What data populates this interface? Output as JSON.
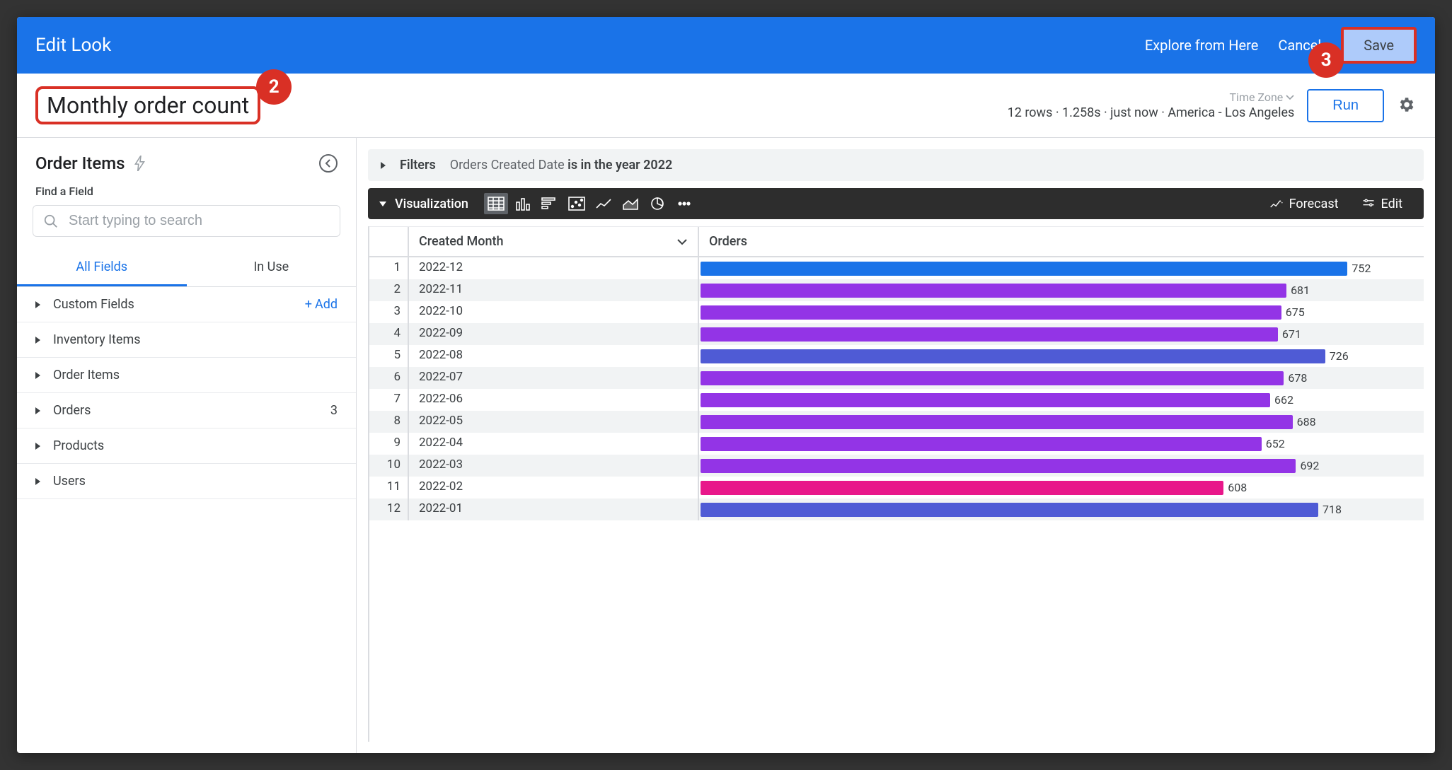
{
  "header": {
    "title": "Edit Look",
    "explore_label": "Explore from Here",
    "cancel_label": "Cancel",
    "save_label": "Save"
  },
  "callouts": {
    "title": "2",
    "save": "3"
  },
  "look": {
    "title": "Monthly order count",
    "stats": "12 rows · 1.258s · just now · America - Los Angeles",
    "timezone_label": "Time Zone",
    "run_label": "Run"
  },
  "sidebar": {
    "explore_name": "Order Items",
    "find_label": "Find a Field",
    "search_placeholder": "Start typing to search",
    "tabs": {
      "all": "All Fields",
      "in_use": "In Use"
    },
    "add_label": "Add",
    "groups": [
      {
        "name": "Custom Fields",
        "add": true
      },
      {
        "name": "Inventory Items"
      },
      {
        "name": "Order Items"
      },
      {
        "name": "Orders",
        "count": 3
      },
      {
        "name": "Products"
      },
      {
        "name": "Users"
      }
    ]
  },
  "filters": {
    "label": "Filters",
    "dim": "Orders Created Date",
    "cond": "is in the year 2022"
  },
  "viz": {
    "label": "Visualization",
    "forecast": "Forecast",
    "edit": "Edit"
  },
  "columns": {
    "month": "Created Month",
    "orders": "Orders"
  },
  "chart_data": {
    "type": "bar",
    "title": "Monthly order count",
    "xlabel": "Created Month",
    "ylabel": "Orders",
    "ylim": [
      0,
      800
    ],
    "categories": [
      "2022-12",
      "2022-11",
      "2022-10",
      "2022-09",
      "2022-08",
      "2022-07",
      "2022-06",
      "2022-05",
      "2022-04",
      "2022-03",
      "2022-02",
      "2022-01"
    ],
    "values": [
      752,
      681,
      675,
      671,
      726,
      678,
      662,
      688,
      652,
      692,
      608,
      718
    ],
    "bar_colors": [
      "#1a73e8",
      "#9334e6",
      "#9334e6",
      "#9334e6",
      "#4f5bd5",
      "#9334e6",
      "#9334e6",
      "#9334e6",
      "#9334e6",
      "#9334e6",
      "#e8178a",
      "#4f5bd5"
    ]
  }
}
